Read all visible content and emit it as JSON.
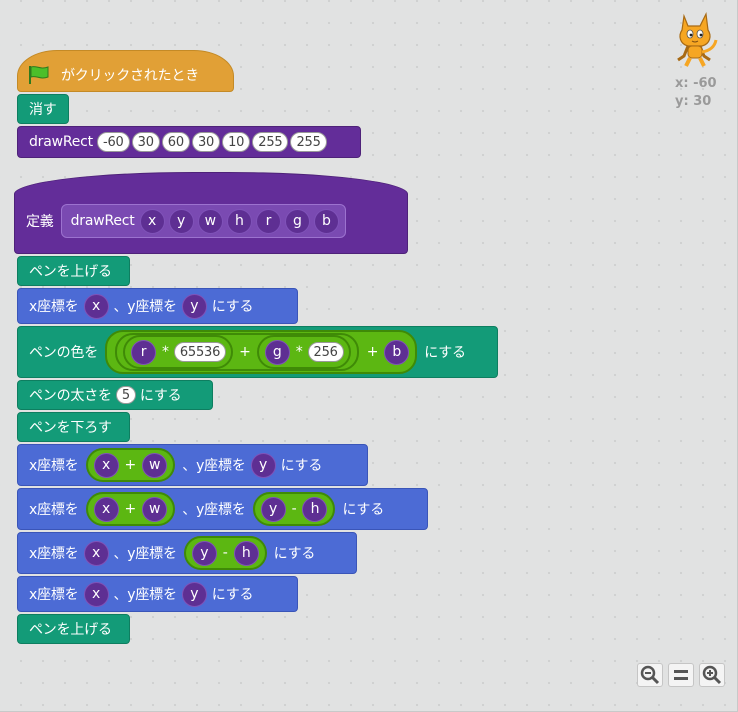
{
  "script": {
    "hat_event": {
      "label": "がクリックされたとき",
      "icon": "green-flag-icon"
    },
    "clear": {
      "label": "消す"
    },
    "call_drawrect": {
      "name": "drawRect",
      "args": [
        "-60",
        "30",
        "60",
        "30",
        "10",
        "255",
        "255"
      ]
    },
    "define": {
      "label": "定義",
      "name": "drawRect",
      "params": [
        "x",
        "y",
        "w",
        "h",
        "r",
        "g",
        "b"
      ]
    },
    "pen_up_1": {
      "label": "ペンを上げる"
    },
    "goto_1": {
      "x_label": "x座標を",
      "x": "x",
      "sep": "、y座標を",
      "y": "y",
      "suffix": "にする"
    },
    "set_color": {
      "label": "ペンの色を",
      "suffix": "にする",
      "r": "r",
      "times1": "*",
      "n1": "65536",
      "plus1": "+",
      "g": "g",
      "times2": "*",
      "n2": "256",
      "plus2": "+",
      "b": "b"
    },
    "set_size": {
      "label": "ペンの太さを",
      "value": "5",
      "suffix": "にする"
    },
    "pen_down": {
      "label": "ペンを下ろす"
    },
    "goto_2": {
      "x_label": "x座標を",
      "x1": "x",
      "plus": "+",
      "x2": "w",
      "sep": "、y座標を",
      "y": "y",
      "suffix": "にする"
    },
    "goto_3": {
      "x_label": "x座標を",
      "x1": "x",
      "plus": "+",
      "x2": "w",
      "sep": "、y座標を",
      "y1": "y",
      "minus": "-",
      "y2": "h",
      "suffix": "にする"
    },
    "goto_4": {
      "x_label": "x座標を",
      "x": "x",
      "sep": "、y座標を",
      "y1": "y",
      "minus": "-",
      "y2": "h",
      "suffix": "にする"
    },
    "goto_5": {
      "x_label": "x座標を",
      "x": "x",
      "sep": "、y座標を",
      "y": "y",
      "suffix": "にする"
    },
    "pen_up_2": {
      "label": "ペンを上げる"
    }
  },
  "sprite": {
    "x_text": "x: -60",
    "y_text": "y: 30",
    "icon": "cat-sprite-icon"
  },
  "zoom": {
    "out_icon": "zoom-out-icon",
    "reset_icon": "zoom-reset-icon",
    "in_icon": "zoom-in-icon"
  },
  "colors": {
    "events": "#e1a036",
    "pen": "#139b78",
    "motion": "#4c6bd5",
    "more_blocks": "#632d99",
    "operators": "#5cb712",
    "canvas": "#e1e2e2"
  }
}
